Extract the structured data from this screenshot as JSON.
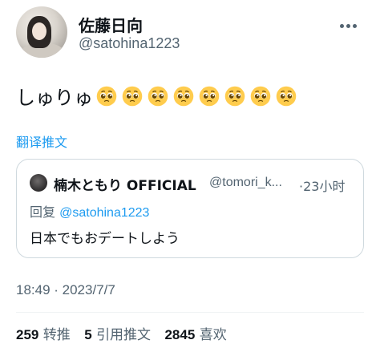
{
  "author": {
    "name": "佐藤日向",
    "handle": "@satohina1223"
  },
  "tweet": {
    "text": "しゅりゅ",
    "emoji_count": 8,
    "emoji_name": "pleading-face"
  },
  "translate_label": "翻译推文",
  "quoted": {
    "name": "楠木ともり OFFICIAL",
    "handle": "@tomori_k...",
    "separator": "·",
    "time": "23小时",
    "reply_prefix": "回复",
    "reply_to": "@satohina1223",
    "body": "日本でもおデートしよう"
  },
  "timestamp": "18:49 · 2023/7/7",
  "stats": {
    "retweets": "259",
    "retweets_label": "转推",
    "quotes": "5",
    "quotes_label": "引用推文",
    "likes": "2845",
    "likes_label": "喜欢"
  },
  "colors": {
    "accent": "#1d9bf0",
    "secondary_text": "#536471",
    "border": "#cfd9de"
  }
}
